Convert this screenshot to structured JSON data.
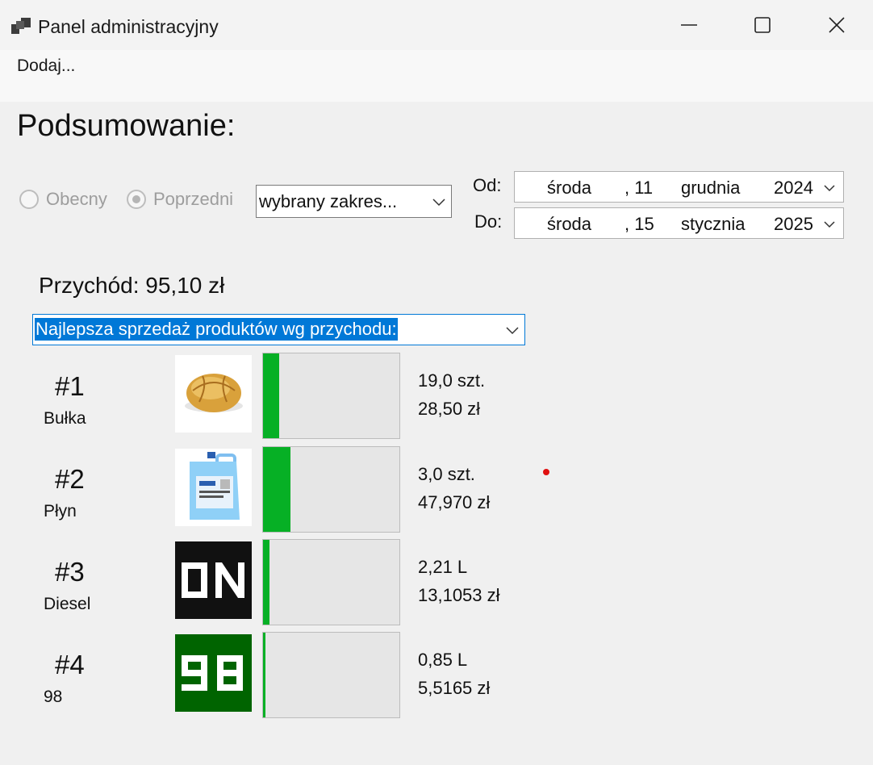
{
  "window": {
    "title": "Panel administracyjny"
  },
  "menu": {
    "add_label": "Dodaj..."
  },
  "summary": {
    "heading": "Podsumowanie:",
    "radio_current": "Obecny",
    "radio_previous": "Poprzedni",
    "range_select": "wybrany zakres...",
    "from_label": "Od:",
    "to_label": "Do:",
    "from_date": {
      "weekday": "środa",
      "day": ", 11",
      "month": "grudnia",
      "year": "2024"
    },
    "to_date": {
      "weekday": "środa",
      "day": ", 15",
      "month": "stycznia",
      "year": "2025"
    },
    "revenue": "Przychód: 95,10 zł",
    "ranking_select": "Najlepsza sprzedaż produktów wg przychodu:"
  },
  "products": [
    {
      "rank": "#1",
      "name": "Bułka",
      "qty": "19,0 szt.",
      "amount": "28,50 zł",
      "progress": 0.12,
      "image": "bread-roll-image"
    },
    {
      "rank": "#2",
      "name": "Płyn",
      "qty": "3,0 szt.",
      "amount": "47,970 zł",
      "progress": 0.2,
      "image": "fluid-canister-image"
    },
    {
      "rank": "#3",
      "name": "Diesel",
      "qty": "2,21 L",
      "amount": "13,1053 zł",
      "progress": 0.05,
      "image": "on-pixel-logo",
      "image_text": "ON"
    },
    {
      "rank": "#4",
      "name": "98",
      "qty": "0,85 L",
      "amount": "5,5165 zł",
      "progress": 0.02,
      "image": "98-pixel-logo",
      "image_text": "98"
    }
  ],
  "colors": {
    "progress_fill": "#06b025",
    "selection": "#0078d7",
    "on_tile": "#111111",
    "tile_98": "#006400"
  }
}
